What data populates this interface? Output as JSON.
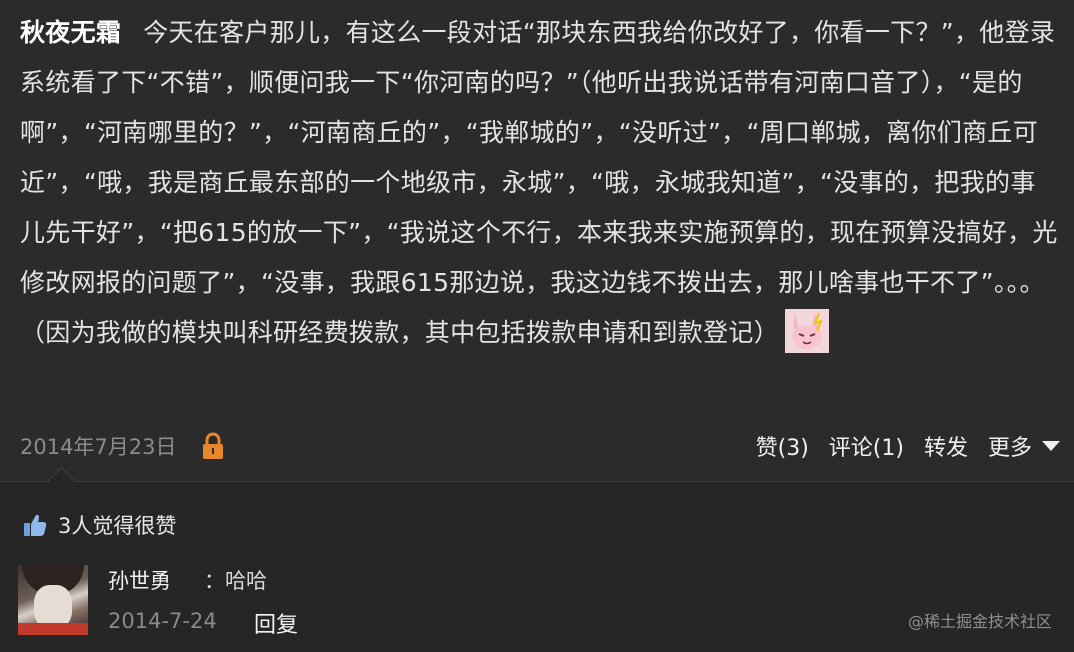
{
  "post": {
    "author": "秋夜无霜",
    "text": "今天在客户那儿，有这么一段对话“那块东西我给你改好了，你看一下？”，他登录系统看了下“不错”，顺便问我一下“你河南的吗？”（他听出我说话带有河南口音了），“是的啊”，“河南哪里的？”，“河南商丘的”，“我郸城的”，“没听过”，“周口郸城，离你们商丘可近”，“哦，我是商丘最东部的一个地级市，永城”，“哦，永城我知道”，“没事的，把我的事儿先干好”，“把615的放一下”，“我说这个不行，本来我来实施预算的，现在预算没搞好，光修改网报的问题了”，“没事，我跟615那边说，我这边钱不拨出去，那儿啥事也干不了”。。。（因为我做的模块叫科研经费拨款，其中包括拨款申请和到款登记）",
    "emoji_icon": "pink-rabbit-emoji-icon",
    "date": "2014年7月23日",
    "lock_icon": "lock-icon",
    "actions": {
      "like": "赞(3)",
      "comment": "评论(1)",
      "share": "转发",
      "more": "更多"
    }
  },
  "likes": {
    "icon": "thumbs-up-icon",
    "text": "3人觉得很赞"
  },
  "comments": [
    {
      "name": "孙世勇",
      "text": "：哈哈",
      "date": "2014-7-24",
      "reply": "回复"
    }
  ],
  "watermark": "@稀土掘金技术社区",
  "colors": {
    "background": "#2b2b2b",
    "comment_background": "#262626",
    "lock": "#e8862a",
    "thumb": "#6ea0e0"
  }
}
